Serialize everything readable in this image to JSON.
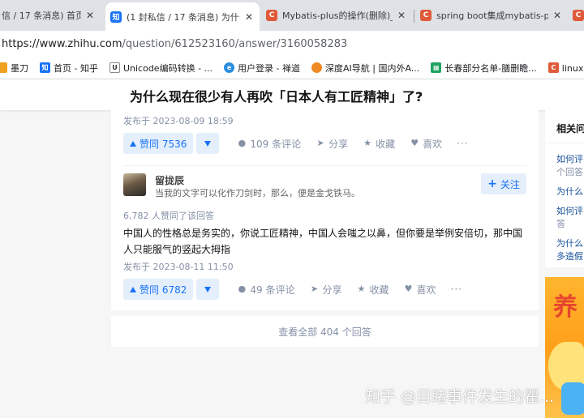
{
  "browser": {
    "tabs": [
      {
        "title": "信 / 17 条消息) 首页 - 知",
        "icon": "zhihu-icon",
        "active": false
      },
      {
        "title": "(1 封私信 / 17 条消息) 为什么现",
        "icon": "zhihu-icon",
        "active": true
      },
      {
        "title": "Mybatis-plus的操作(删除)_myb",
        "icon": "csdn-icon",
        "active": false
      },
      {
        "title": "spring boot集成mybatis-plus",
        "icon": "csdn-icon",
        "active": false
      }
    ],
    "close_glyph": "✕",
    "url_host": "https://www.zhihu.com",
    "url_path": "/question/612523160/answer/3160058283",
    "bookmarks": [
      {
        "label": "墨刀",
        "icon": "bookmark-icon"
      },
      {
        "label": "首页 - 知乎",
        "icon": "zhihu-icon"
      },
      {
        "label": "Unicode编码转换 - ...",
        "icon": "unicode-icon"
      },
      {
        "label": "用户登录 - 禅道",
        "icon": "globe-icon"
      },
      {
        "label": "深度AI导航 | 国内外A...",
        "icon": "ai-nav-icon"
      },
      {
        "label": "长春部分名单-膳删瞻...",
        "icon": "sheet-icon"
      },
      {
        "label": "linux离线安装pos",
        "icon": "csdn-icon"
      }
    ],
    "colors": {
      "zhihu": "#1772f6",
      "csdn": "#e05a3a"
    }
  },
  "question": {
    "title": "为什么现在很少有人再吹「日本人有工匠精神」了?"
  },
  "answer1": {
    "date": "发布于 2023-08-09 18:59",
    "upvote_label": "赞同 7536",
    "comments": "109 条评论",
    "share": "分享",
    "favorite": "收藏",
    "like": "喜欢",
    "more": "···"
  },
  "answer2": {
    "author": "留拢辰",
    "bio": "当我的文字可以化作刀剑时，那么，便是金戈铁马。",
    "follow": "关注",
    "upvote_info": "6,782 人赞同了该回答",
    "content": "中国人的性格总是务实的，你说工匠精神，中国人会嗤之以鼻，但你要是举例安倍切，那中国人只能服气的竖起大拇指",
    "date": "发布于 2023-08-11 11:50",
    "upvote_label": "赞同 6782",
    "comments": "49 条评论",
    "share": "分享",
    "favorite": "收藏",
    "like": "喜欢",
    "more": "···"
  },
  "view_all": "查看全部 404 个回答",
  "sidebar": {
    "title": "相关问",
    "items": [
      {
        "q": "如何评",
        "sub": "个回答"
      },
      {
        "q": "为什么"
      },
      {
        "q": "如何评",
        "sub": "答"
      },
      {
        "q": "为什么",
        "q2": "多造假"
      }
    ]
  },
  "ad": {
    "big": "养"
  },
  "watermark": "知乎 @目睹事件发生的瞿..."
}
